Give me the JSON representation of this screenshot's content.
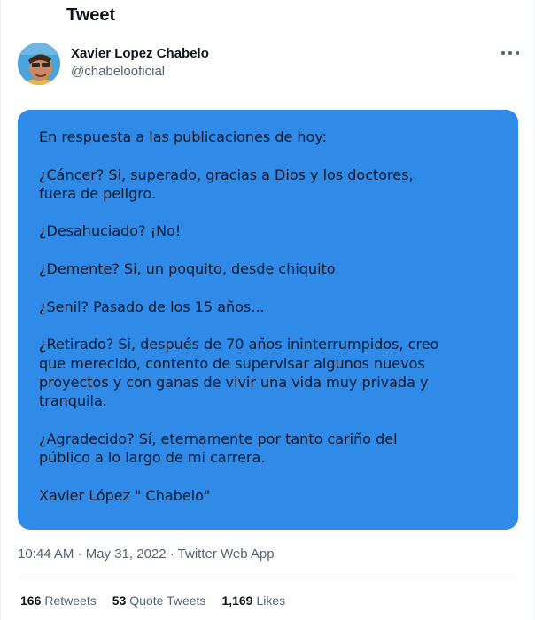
{
  "header": {
    "title": "Tweet"
  },
  "author": {
    "name": "Xavier Lopez Chabelo",
    "handle": "@chabelooficial"
  },
  "tweet": {
    "card_paragraphs": [
      "En respuesta a las publicaciones de hoy:",
      "¿Cáncer? Si, superado, gracias a Dios y los doctores,\nfuera de peligro.",
      "¿Desahuciado? ¡No!",
      "¿Demente? Si, un poquito, desde chiquito",
      "¿Senil? Pasado de los 15 años...",
      "¿Retirado? Si, después de 70 años ininterrumpidos, creo\nque merecido, contento de supervisar algunos nuevos\nproyectos y con ganas de vivir una vida muy privada y\ntranquila.",
      "¿Agradecido? Sí, eternamente por tanto cariño del\npúblico a lo largo de mi carrera.",
      "Xavier López \" Chabelo\""
    ],
    "card_color": "#2f8ae8",
    "timestamp": "10:44 AM · May 31, 2022 · Twitter Web App"
  },
  "stats": {
    "retweets_count": "166",
    "retweets_label": "Retweets",
    "quotes_count": "53",
    "quotes_label": "Quote Tweets",
    "likes_count": "1,169",
    "likes_label": "Likes"
  }
}
